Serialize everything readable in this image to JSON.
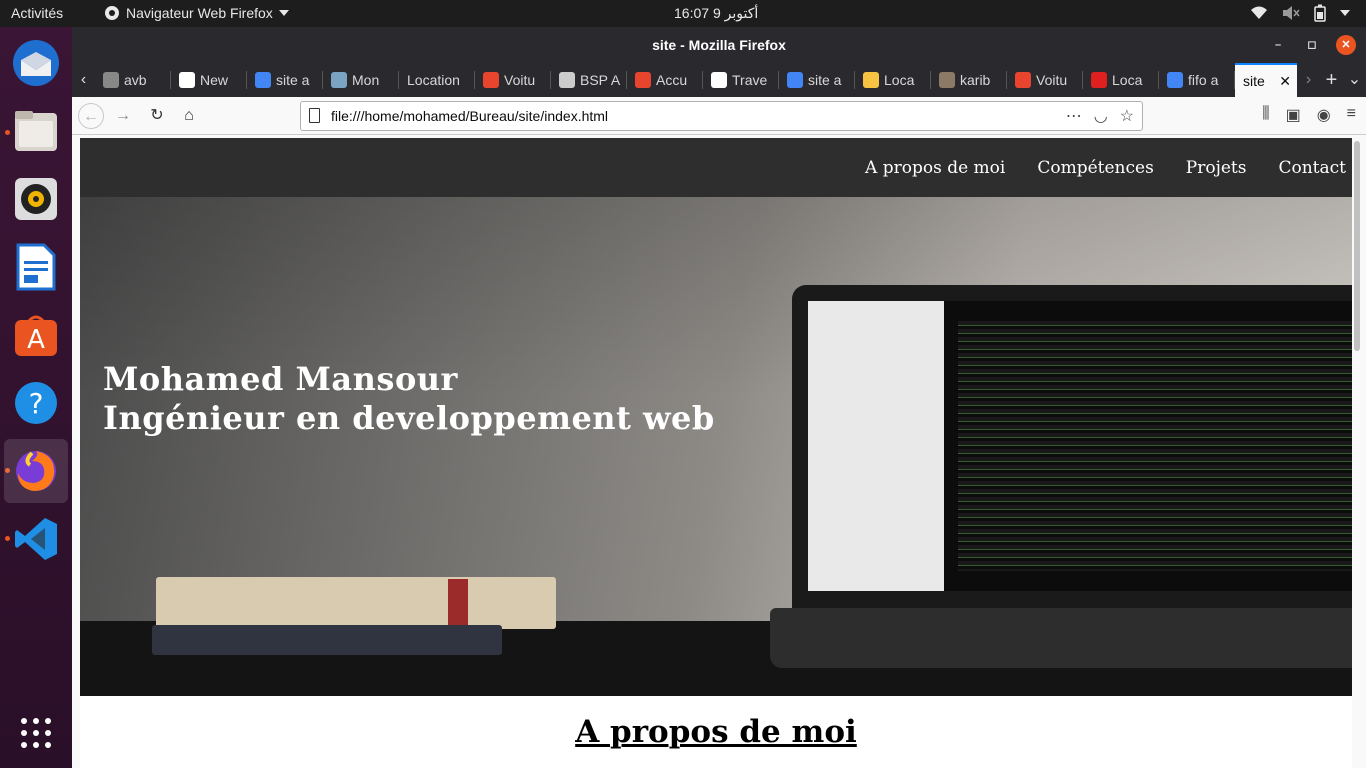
{
  "topbar": {
    "activities": "Activités",
    "app_menu": "Navigateur Web Firefox",
    "clock": "16:07  أكتوبر 9",
    "tray_icons": [
      "wifi-icon",
      "volume-muted-icon",
      "battery-icon",
      "power-menu-icon"
    ]
  },
  "dock": {
    "apps": [
      "thunderbird",
      "files",
      "rhythmbox",
      "libreoffice-writer",
      "ubuntu-software",
      "help",
      "firefox",
      "vscode",
      "show-applications"
    ]
  },
  "window": {
    "title": "site - Mozilla Firefox"
  },
  "tabs": [
    {
      "label": "avb",
      "favicon_color": "#888888"
    },
    {
      "label": "New",
      "favicon_color": "#ffffff"
    },
    {
      "label": "site a",
      "favicon_color": "#4285f4"
    },
    {
      "label": "Mon",
      "favicon_color": "#7aa3c4"
    },
    {
      "label": "Location",
      "favicon_color": ""
    },
    {
      "label": "Voitu",
      "favicon_color": "#e8442e"
    },
    {
      "label": "BSP A",
      "favicon_color": "#cccccc"
    },
    {
      "label": "Accu",
      "favicon_color": "#e8442e"
    },
    {
      "label": "Trave",
      "favicon_color": "#ffffff"
    },
    {
      "label": "site a",
      "favicon_color": "#4285f4"
    },
    {
      "label": "Loca",
      "favicon_color": "#f6c343"
    },
    {
      "label": "karib",
      "favicon_color": "#8a7a66"
    },
    {
      "label": "Voitu",
      "favicon_color": "#e8442e"
    },
    {
      "label": "Loca",
      "favicon_color": "#e02020"
    },
    {
      "label": "fifo a",
      "favicon_color": "#4285f4"
    },
    {
      "label": "site",
      "favicon_color": ""
    }
  ],
  "address_bar": {
    "url": "file:///home/mohamed/Bureau/site/index.html"
  },
  "site": {
    "nav": [
      "A propos de moi",
      "Compétences",
      "Projets",
      "Contact"
    ],
    "hero_line1": "Mohamed Mansour",
    "hero_line2": "Ingénieur en developpement web",
    "about_title": "A propos de moi"
  },
  "colors": {
    "accent": "#e95420",
    "tab_highlight": "#0a84ff",
    "site_nav_bg": "#2e2e2e"
  }
}
